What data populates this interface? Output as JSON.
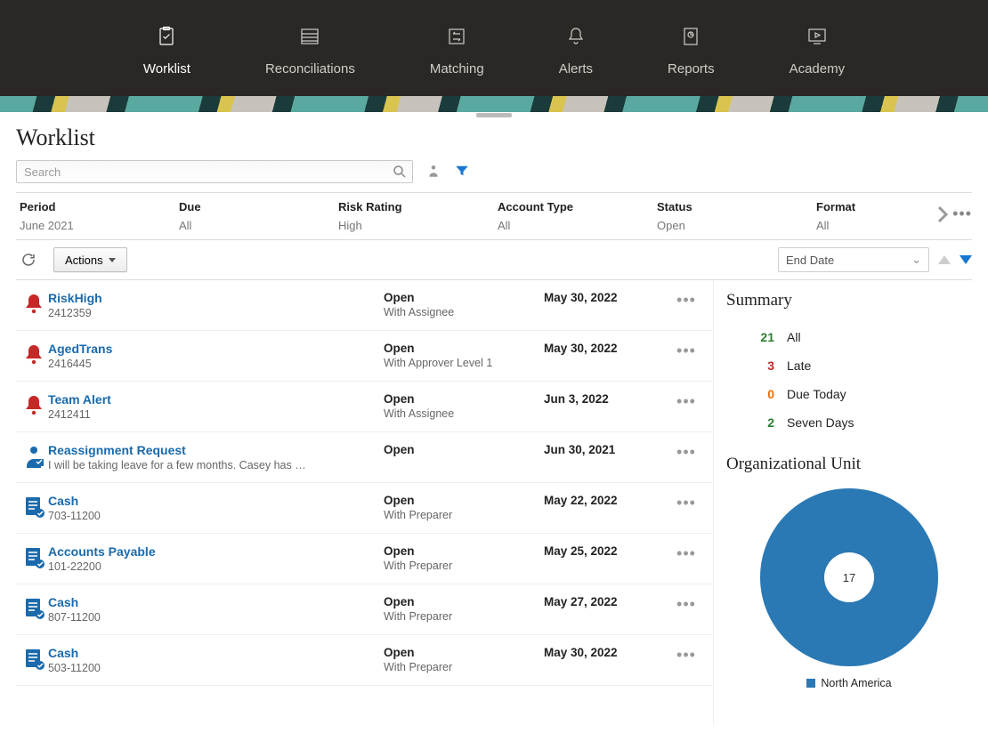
{
  "nav": {
    "items": [
      {
        "label": "Worklist",
        "active": true
      },
      {
        "label": "Reconciliations",
        "active": false
      },
      {
        "label": "Matching",
        "active": false
      },
      {
        "label": "Alerts",
        "active": false
      },
      {
        "label": "Reports",
        "active": false
      },
      {
        "label": "Academy",
        "active": false
      }
    ]
  },
  "page": {
    "title": "Worklist"
  },
  "search": {
    "placeholder": "Search"
  },
  "filters": [
    {
      "header": "Period",
      "value": "June 2021"
    },
    {
      "header": "Due",
      "value": "All"
    },
    {
      "header": "Risk Rating",
      "value": "High"
    },
    {
      "header": "Account Type",
      "value": "All"
    },
    {
      "header": "Status",
      "value": "Open"
    },
    {
      "header": "Format",
      "value": "All"
    }
  ],
  "toolbar": {
    "actions_label": "Actions",
    "end_date_label": "End Date"
  },
  "list": [
    {
      "icon": "bell",
      "title": "RiskHigh",
      "sub": "2412359",
      "status": "Open",
      "status_sub": "With Assignee",
      "date": "May 30, 2022"
    },
    {
      "icon": "bell",
      "title": "AgedTrans",
      "sub": "2416445",
      "status": "Open",
      "status_sub": "With Approver Level 1",
      "date": "May 30, 2022"
    },
    {
      "icon": "bell",
      "title": "Team Alert",
      "sub": "2412411",
      "status": "Open",
      "status_sub": "With Assignee",
      "date": "Jun 3, 2022"
    },
    {
      "icon": "person",
      "title": "Reassignment Request",
      "sub": "I will be taking leave for a few months. Casey has …",
      "status": "Open",
      "status_sub": "",
      "date": "Jun 30, 2021"
    },
    {
      "icon": "doc",
      "title": "Cash",
      "sub": "703-11200",
      "status": "Open",
      "status_sub": "With Preparer",
      "date": "May 22, 2022"
    },
    {
      "icon": "doc",
      "title": "Accounts Payable",
      "sub": "101-22200",
      "status": "Open",
      "status_sub": "With Preparer",
      "date": "May 25, 2022"
    },
    {
      "icon": "doc",
      "title": "Cash",
      "sub": "807-11200",
      "status": "Open",
      "status_sub": "With Preparer",
      "date": "May 27, 2022"
    },
    {
      "icon": "doc",
      "title": "Cash",
      "sub": "503-11200",
      "status": "Open",
      "status_sub": "With Preparer",
      "date": "May 30, 2022"
    }
  ],
  "summary": {
    "heading": "Summary",
    "items": [
      {
        "num": "21",
        "label": "All",
        "cls": "num-green"
      },
      {
        "num": "3",
        "label": "Late",
        "cls": "num-red"
      },
      {
        "num": "0",
        "label": "Due Today",
        "cls": "num-orange"
      },
      {
        "num": "2",
        "label": "Seven Days",
        "cls": "num-green"
      }
    ]
  },
  "org": {
    "heading": "Organizational Unit",
    "legend_label": "North America"
  },
  "chart_data": {
    "type": "pie",
    "title": "Organizational Unit",
    "center_value": 17,
    "series": [
      {
        "name": "North America",
        "value": 17,
        "color": "#2a79b5"
      }
    ]
  }
}
